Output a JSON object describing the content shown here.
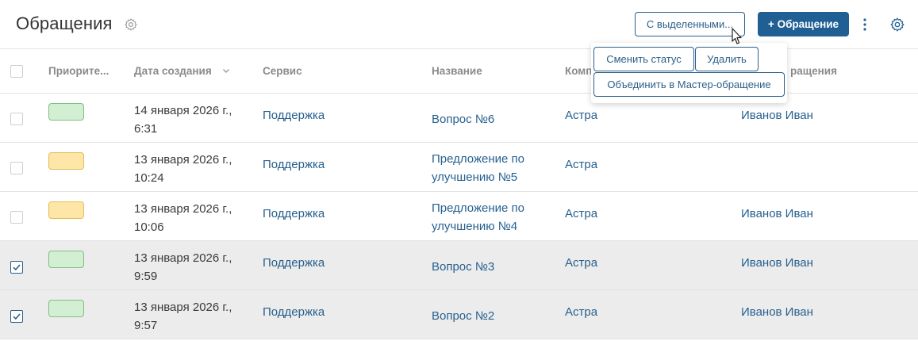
{
  "header": {
    "title": "Обращения",
    "selected_label": "С выделенными...",
    "create_label": "+ Обращение"
  },
  "columns": {
    "priority": "Приорите...",
    "created": "Дата создания",
    "service": "Сервис",
    "name": "Название",
    "company": "Комп",
    "initiator": "ращения"
  },
  "dropdown": {
    "change_status": "Сменить статус",
    "delete": "Удалить",
    "merge": "Объединить в Мастер-обращение"
  },
  "rows": [
    {
      "checked": false,
      "priority": "green",
      "date1": "14 января 2026 г.,",
      "date2": "6:31",
      "service": "Поддержка",
      "name1": "Вопрос №6",
      "name2": "",
      "company": "Астра",
      "initiator": "Иванов Иван"
    },
    {
      "checked": false,
      "priority": "yellow",
      "date1": "13 января 2026 г.,",
      "date2": "10:24",
      "service": "Поддержка",
      "name1": "Предложение по",
      "name2": "улучшению №5",
      "company": "Астра",
      "initiator": ""
    },
    {
      "checked": false,
      "priority": "yellow",
      "date1": "13 января 2026 г.,",
      "date2": "10:06",
      "service": "Поддержка",
      "name1": "Предложение по",
      "name2": "улучшению №4",
      "company": "Астра",
      "initiator": "Иванов Иван"
    },
    {
      "checked": true,
      "priority": "green",
      "date1": "13 января 2026 г.,",
      "date2": "9:59",
      "service": "Поддержка",
      "name1": "Вопрос №3",
      "name2": "",
      "company": "Астра",
      "initiator": "Иванов Иван"
    },
    {
      "checked": true,
      "priority": "green",
      "date1": "13 января 2026 г.,",
      "date2": "9:57",
      "service": "Поддержка",
      "name1": "Вопрос №2",
      "name2": "",
      "company": "Астра",
      "initiator": "Иванов Иван"
    }
  ],
  "colors": {
    "accent": "#1f5f93",
    "link": "#27608f",
    "selected_row": "#ececec",
    "priority_green": "#d3efd3",
    "priority_yellow": "#fde6a8"
  },
  "icons": [
    "settings-gear-icon",
    "kebab-menu-icon",
    "chevron-down-icon",
    "checkmark-icon",
    "mouse-cursor-icon"
  ]
}
